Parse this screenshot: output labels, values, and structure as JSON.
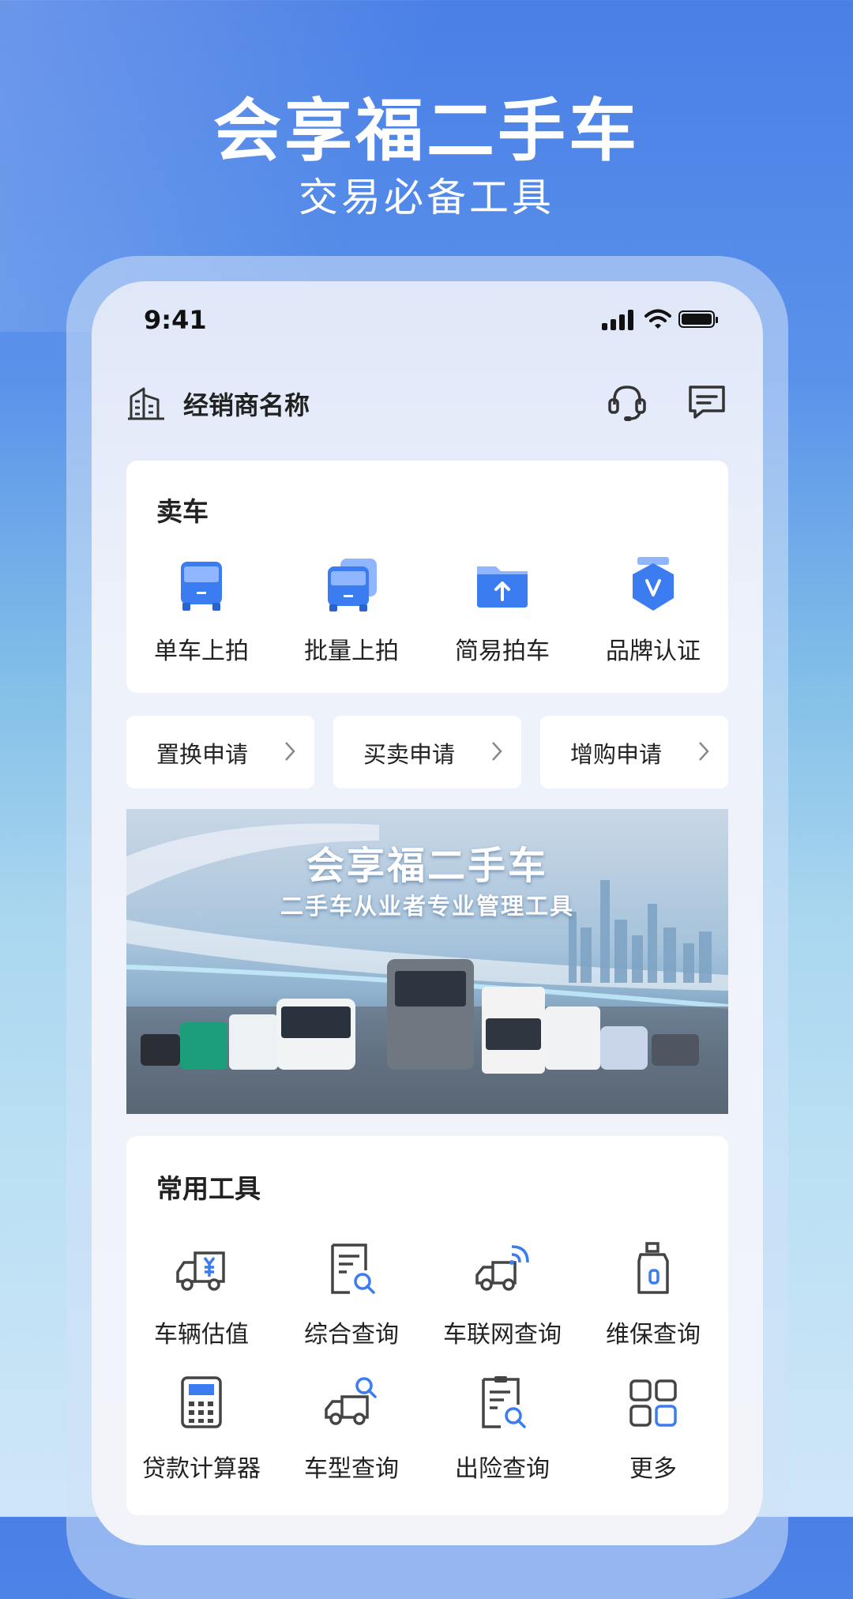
{
  "hero": {
    "title": "会享福二手车",
    "subtitle": "交易必备工具"
  },
  "status_bar": {
    "time": "9:41"
  },
  "header": {
    "dealer_name": "经销商名称"
  },
  "sell_section": {
    "title": "卖车",
    "items": [
      {
        "label": "单车上拍",
        "icon": "truck-icon"
      },
      {
        "label": "批量上拍",
        "icon": "multi-truck-icon"
      },
      {
        "label": "简易拍车",
        "icon": "folder-upload-icon"
      },
      {
        "label": "品牌认证",
        "icon": "brand-badge-icon"
      }
    ]
  },
  "applications": [
    {
      "label": "置换申请"
    },
    {
      "label": "买卖申请"
    },
    {
      "label": "增购申请"
    }
  ],
  "banner": {
    "title": "会享福二手车",
    "subtitle": "二手车从业者专业管理工具"
  },
  "tools_section": {
    "title": "常用工具",
    "items": [
      {
        "label": "车辆估值",
        "icon": "vehicle-valuation-icon"
      },
      {
        "label": "综合查询",
        "icon": "document-search-icon"
      },
      {
        "label": "车联网查询",
        "icon": "connected-truck-icon"
      },
      {
        "label": "维保查询",
        "icon": "maintenance-oil-icon"
      },
      {
        "label": "贷款计算器",
        "icon": "calculator-icon"
      },
      {
        "label": "车型查询",
        "icon": "truck-search-icon"
      },
      {
        "label": "出险查询",
        "icon": "clipboard-search-icon"
      },
      {
        "label": "更多",
        "icon": "grid-more-icon"
      }
    ]
  },
  "colors": {
    "accent": "#3b7cf0",
    "icon_light": "#8fb6ff",
    "text": "#222222"
  }
}
